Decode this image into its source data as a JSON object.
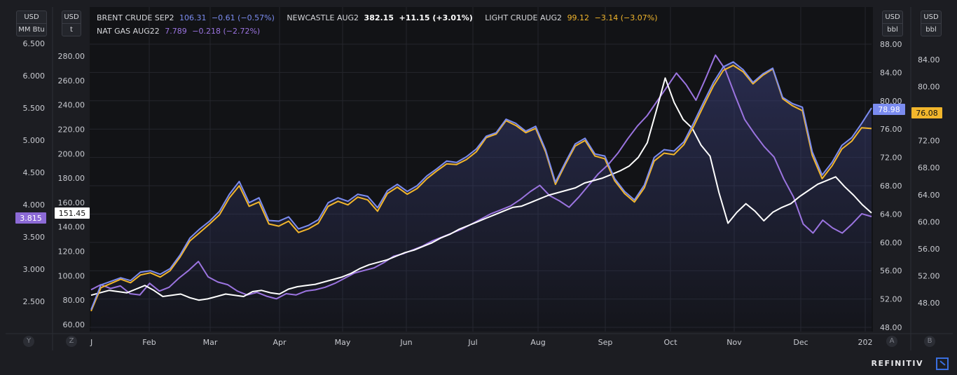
{
  "legend": {
    "row1": [
      {
        "name": "BRENT CRUDE SEP2",
        "last": "106.31",
        "change": "−0.61 (−0.57%)",
        "color": "#7b8cf0"
      },
      {
        "name": "NEWCASTLE AUG2",
        "last": "382.15",
        "change": "+11.15 (+3.01%)",
        "color": "#ffffff"
      },
      {
        "name": "LIGHT CRUDE AUG2",
        "last": "99.12",
        "change": "−3.14 (−3.07%)",
        "color": "#f2b62c"
      }
    ],
    "row2": [
      {
        "name": "NAT GAS AUG22",
        "last": "7.789",
        "change": "−0.218 (−2.72%)",
        "color": "#9b74e0"
      }
    ]
  },
  "axis_units": {
    "far_left": [
      "USD",
      "MM Btu"
    ],
    "left": [
      "USD",
      "t"
    ],
    "right": [
      "USD",
      "bbl"
    ],
    "far_right": [
      "USD",
      "bbl"
    ]
  },
  "axis_buttons": {
    "y": "Y",
    "z": "Z",
    "a": "A",
    "b": "B"
  },
  "badges": {
    "nat_gas": {
      "text": "3.815",
      "color": "#8c6ad6"
    },
    "newcastle": {
      "text": "151.45",
      "color": "#ffffff"
    },
    "brent": {
      "text": "78.98",
      "color": "#7b8cf0"
    },
    "light_crude": {
      "text": "76.08",
      "color": "#f2b62c"
    }
  },
  "brand": "REFINITIV",
  "chart_data": {
    "type": "line",
    "title": "",
    "x_labels": [
      "Feb",
      "Mar",
      "Apr",
      "May",
      "Jun",
      "Jul",
      "Aug",
      "Sep",
      "Oct",
      "Nov",
      "Dec",
      "202"
    ],
    "x_start_label": "J",
    "axes": {
      "y_far_left": {
        "unit": "USD / MM Btu",
        "ticks": [
          "6.500",
          "6.000",
          "5.500",
          "5.000",
          "4.500",
          "4.000",
          "3.500",
          "3.000",
          "2.500"
        ],
        "range": [
          2.5,
          6.5
        ]
      },
      "y_left": {
        "unit": "USD / t",
        "ticks": [
          "280.00",
          "260.00",
          "240.00",
          "220.00",
          "200.00",
          "180.00",
          "160.00",
          "140.00",
          "120.00",
          "100.00",
          "80.00",
          "60.00"
        ],
        "range": [
          60,
          280
        ]
      },
      "y_right": {
        "unit": "USD / bbl",
        "ticks": [
          "88.00",
          "84.00",
          "80.00",
          "76.00",
          "72.00",
          "68.00",
          "64.00",
          "60.00",
          "56.00",
          "52.00",
          "48.00"
        ],
        "range": [
          48,
          88
        ]
      },
      "y_far_right": {
        "unit": "USD / bbl",
        "ticks": [
          "84.00",
          "80.00",
          "76.00",
          "72.00",
          "68.00",
          "64.00",
          "60.00",
          "56.00",
          "52.00",
          "48.00"
        ],
        "range": [
          44,
          88
        ]
      }
    },
    "series": [
      {
        "name": "BRENT CRUDE SEP2",
        "axis": "y_right",
        "color": "#7b8cf0",
        "values": [
          50.5,
          54.0,
          54.5,
          55.0,
          54.6,
          55.8,
          56.0,
          55.5,
          56.3,
          58.2,
          60.6,
          61.9,
          63.0,
          64.4,
          66.8,
          68.6,
          65.6,
          66.3,
          63.1,
          63.0,
          63.6,
          61.9,
          62.4,
          63.2,
          65.6,
          66.3,
          65.8,
          66.8,
          66.5,
          64.9,
          67.3,
          68.2,
          67.2,
          68.0,
          69.4,
          70.4,
          71.5,
          71.3,
          72.1,
          73.2,
          75.0,
          75.5,
          77.4,
          76.8,
          75.7,
          76.4,
          73.1,
          68.5,
          71.3,
          73.9,
          74.7,
          72.5,
          72.2,
          69.0,
          67.2,
          66.0,
          68.1,
          72.0,
          73.1,
          72.9,
          74.2,
          76.9,
          79.8,
          82.6,
          84.8,
          85.5,
          84.4,
          82.6,
          83.8,
          84.6,
          80.5,
          79.6,
          79.1,
          72.8,
          69.5,
          71.3,
          73.7,
          74.8,
          76.8,
          78.98
        ]
      },
      {
        "name": "LIGHT CRUDE AUG2",
        "axis": "y_right",
        "color": "#f2b62c",
        "values": [
          50.3,
          53.6,
          54.2,
          54.8,
          54.3,
          55.4,
          55.7,
          55.1,
          56.0,
          57.9,
          60.2,
          61.4,
          62.6,
          63.9,
          66.3,
          68.0,
          65.1,
          65.7,
          62.6,
          62.3,
          63.0,
          61.4,
          61.9,
          62.7,
          65.1,
          65.8,
          65.3,
          66.4,
          66.0,
          64.4,
          66.9,
          67.8,
          66.8,
          67.6,
          69.0,
          70.1,
          71.1,
          71.0,
          71.7,
          72.8,
          74.8,
          75.3,
          77.2,
          76.5,
          75.5,
          76.1,
          72.8,
          68.2,
          71.0,
          73.6,
          74.4,
          72.2,
          71.8,
          68.7,
          66.9,
          65.7,
          67.7,
          71.5,
          72.6,
          72.4,
          73.8,
          76.4,
          79.3,
          82.1,
          84.3,
          85.0,
          84.1,
          82.4,
          83.6,
          84.5,
          80.3,
          79.3,
          78.6,
          72.3,
          69.0,
          70.8,
          73.2,
          74.3,
          76.2,
          76.08
        ]
      },
      {
        "name": "NEWCASTLE AUG2",
        "axis": "y_left",
        "color": "#ffffff",
        "values": [
          84,
          86,
          88,
          87,
          86,
          89,
          92,
          88,
          83,
          84,
          85,
          82,
          80,
          81,
          83,
          85,
          84,
          83,
          87,
          88,
          86,
          85,
          89,
          91,
          92,
          93,
          95,
          97,
          99,
          102,
          106,
          109,
          111,
          113,
          116,
          119,
          121,
          124,
          127,
          131,
          134,
          138,
          141,
          144,
          147,
          150,
          153,
          156,
          157,
          160,
          163,
          166,
          168,
          170,
          172,
          176,
          178,
          180,
          183,
          186,
          190,
          197,
          209,
          235,
          262,
          242,
          228,
          221,
          207,
          198,
          168,
          143,
          152,
          159,
          153,
          145,
          152,
          156,
          159,
          165,
          170,
          175,
          178,
          181,
          173,
          166,
          158,
          151.45
        ]
      },
      {
        "name": "NAT GAS AUG22",
        "axis": "y_far_left",
        "color": "#9b74e0",
        "values": [
          2.68,
          2.76,
          2.7,
          2.74,
          2.62,
          2.6,
          2.78,
          2.66,
          2.72,
          2.86,
          2.98,
          3.12,
          2.88,
          2.8,
          2.76,
          2.66,
          2.6,
          2.64,
          2.58,
          2.54,
          2.62,
          2.6,
          2.66,
          2.68,
          2.72,
          2.78,
          2.86,
          2.94,
          2.98,
          3.02,
          3.1,
          3.2,
          3.24,
          3.3,
          3.36,
          3.44,
          3.5,
          3.56,
          3.62,
          3.7,
          3.78,
          3.86,
          3.92,
          3.98,
          4.08,
          4.2,
          4.3,
          4.14,
          4.06,
          3.96,
          4.12,
          4.3,
          4.48,
          4.62,
          4.8,
          5.02,
          5.22,
          5.38,
          5.6,
          5.82,
          6.04,
          5.86,
          5.62,
          5.96,
          6.32,
          6.1,
          5.7,
          5.32,
          5.1,
          4.9,
          4.74,
          4.4,
          4.12,
          3.7,
          3.56,
          3.76,
          3.64,
          3.56,
          3.7,
          3.86,
          3.815
        ]
      }
    ]
  }
}
